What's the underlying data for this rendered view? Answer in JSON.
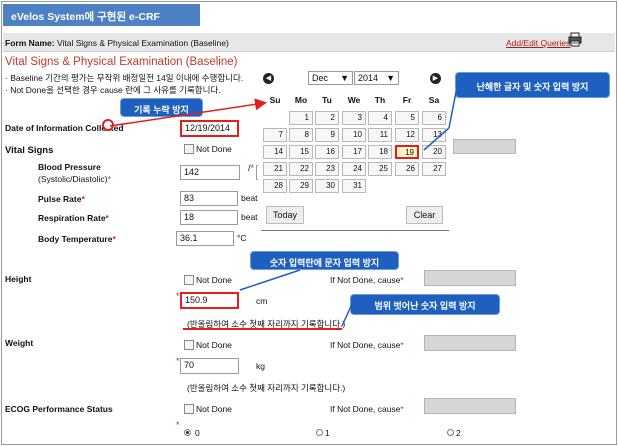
{
  "header": {
    "title": "eVelos System에 구현된 e-CRF"
  },
  "form": {
    "name_label": "Form Name:",
    "name_value": "Vital Signs & Physical Examination (Baseline)",
    "add_edit_queries": "Add/Edit Queries"
  },
  "section": {
    "title": "Vital Signs & Physical Examination (Baseline)"
  },
  "notes": {
    "line1": "· Baseline 기간의 평가는 무작위 배정일전 14일 이내에 수행합니다.",
    "line2": "· Not Done을 선택한 경우 cause 란에 그 사유를 기록합니다."
  },
  "fields": {
    "date_info": {
      "label": "Date of Information Collected",
      "value": "12/19/2014"
    },
    "vital_signs": {
      "label": "Vital Signs",
      "not_done": "Not Done"
    },
    "blood_pressure": {
      "label": "Blood Pressure",
      "sub": "(Systolic/Diastolic)",
      "value": "142",
      "sep": "/"
    },
    "pulse_rate": {
      "label": "Pulse Rate",
      "value": "83",
      "unit": "beats"
    },
    "respiration_rate": {
      "label": "Respiration Rate",
      "value": "18",
      "unit": "beats"
    },
    "body_temperature": {
      "label": "Body Temperature",
      "value": "36.1",
      "unit": "°C"
    },
    "height": {
      "label": "Height",
      "not_done": "Not Done",
      "cause_label": "If Not Done, cause",
      "value": "150.9",
      "unit": "cm",
      "hint": "(반올림하여 소수 첫째 자리까지 기록합니다.)"
    },
    "weight": {
      "label": "Weight",
      "not_done": "Not Done",
      "cause_label": "If Not Done, cause",
      "value": "70",
      "unit": "kg",
      "hint": "(반올림하여 소수 첫째 자리까지 기록합니다.)"
    },
    "ecog": {
      "label": "ECOG Performance Status",
      "not_done": "Not Done",
      "cause_label": "If Not Done, cause",
      "options": [
        "0",
        "1",
        "2"
      ],
      "selected": "0"
    }
  },
  "calendar": {
    "month": "Dec",
    "year": "2014",
    "weekdays": [
      "Su",
      "Mo",
      "Tu",
      "We",
      "Th",
      "Fr",
      "Sa"
    ],
    "weeks": [
      [
        "",
        "1",
        "2",
        "3",
        "4",
        "5",
        "6"
      ],
      [
        "7",
        "8",
        "9",
        "10",
        "11",
        "12",
        "13"
      ],
      [
        "14",
        "15",
        "16",
        "17",
        "18",
        "19",
        "20"
      ],
      [
        "21",
        "22",
        "23",
        "24",
        "25",
        "26",
        "27"
      ],
      [
        "28",
        "29",
        "30",
        "31",
        "",
        "",
        ""
      ]
    ],
    "selected_day": "19",
    "today_label": "Today",
    "clear_label": "Clear"
  },
  "callouts": {
    "missing": "기록 누락 방지",
    "hard_to_read": "난해한 글자 및 숫자 입력 방지",
    "numeric_text": "숫자 입력란에 문자 입력 방지",
    "out_of_range": "범위 벗어난 숫자 입력 방지"
  },
  "colors": {
    "title_bar": "#4e80c4",
    "callout": "#1f5fbf",
    "highlight": "#e21f1f",
    "section_title": "#c0392b"
  }
}
